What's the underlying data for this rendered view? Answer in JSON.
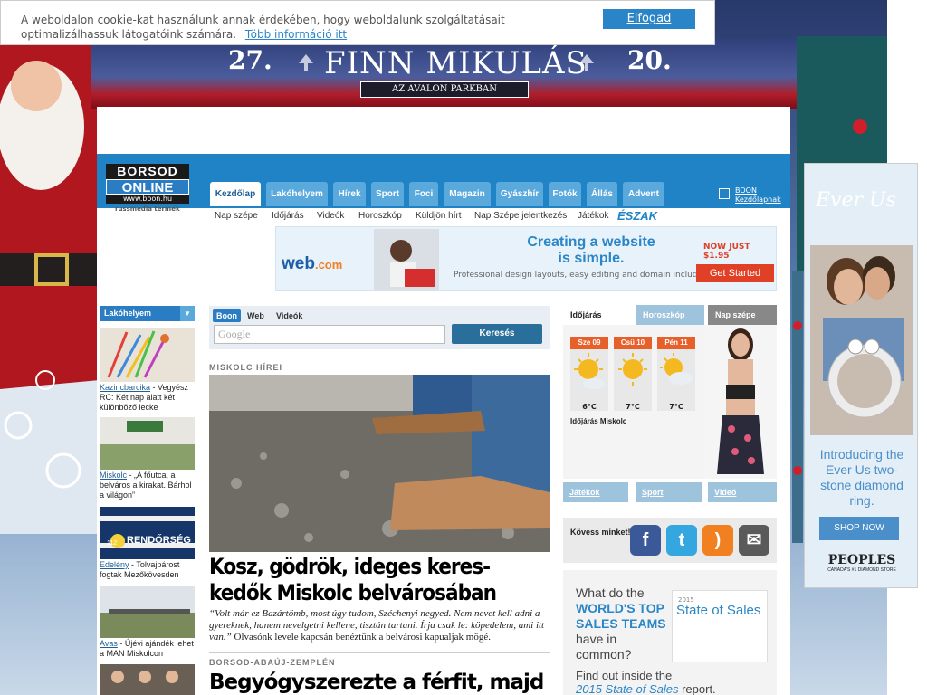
{
  "cookie": {
    "text": "A weboldalon cookie-kat használunk annak érdekében, hogy weboldalunk szolgáltatásait optimalizálhassuk látogatóink számára.",
    "more_link": "Több információ itt",
    "accept_button": "Elfogad"
  },
  "banner": {
    "date_left": "27.",
    "title": "FINN MIKULÁS",
    "date_right": "20.",
    "subtitle": "AZ AVALON PARKBAN"
  },
  "logo": {
    "top": "BORSOD",
    "mid": "ONLINE",
    "url": "www.boon.hu",
    "sub": "russmedia termék"
  },
  "nav": {
    "tabs": [
      "Kezdőlap",
      "Lakóhelyem",
      "Hírek",
      "Sport",
      "Foci",
      "Magazin",
      "Gyászhír",
      "Fotók",
      "Állás",
      "Advent"
    ],
    "active_index": 0,
    "boon_link_line1": "BOON",
    "boon_link_line2": "Kezdőlapnak",
    "subnav": [
      "Nap szépe",
      "Időjárás",
      "Videók",
      "Horoszkóp",
      "Küldjön hírt",
      "Nap Szépe jelentkezés",
      "Játékok"
    ],
    "eszak": "ÉSZAK"
  },
  "webad": {
    "logo": "web",
    "logo_suffix": ".com",
    "headline1": "Creating a website",
    "headline2": "is simple.",
    "small": "Professional design layouts, easy editing and domain included.",
    "price": "NOW JUST $1.95",
    "cta": "Get Started"
  },
  "sidebar": {
    "location_label": "Lakóhelyem",
    "items": [
      {
        "loc": "Kazincbarcika",
        "text": " - Vegyész RC: Két nap alatt két különböző lecke"
      },
      {
        "loc": "Miskolc",
        "text": " - „A főutca, a belváros a kirakat. Bárhol a világon”"
      },
      {
        "loc": "Edelény",
        "text": " - Tolvajpárost fogtak Mezőkövesden"
      },
      {
        "loc": "Avas",
        "text": " - Újévi ajándék lehet a MAN Miskolcon"
      }
    ],
    "rendorseg": "RENDŐRSÉG",
    "phone": "112"
  },
  "search": {
    "tabs": [
      "Boon",
      "Web",
      "Videók"
    ],
    "placeholder": "Google",
    "button": "Keresés"
  },
  "articles": {
    "section1": "MISKOLC HÍREI",
    "headline1": "Kosz, gödrök, ideges keres-kedők Miskolc belvárosában",
    "lead_quote": "“Volt már ez Bazártömb, most úgy tudom, Széchenyi negyed. Nem nevet kell adni a gyereknek, hanem nevelgetni kellene, tisztán tartani. Írja csak le: köpedelem, ami itt van.”",
    "lead_rest": " Olvasónk levele kapcsán benéztünk a belvárosi kapualjak mögé.",
    "section2": "BORSOD-ABAÚJ-ZEMPLÉN",
    "headline2": "Begyógyszerezte a férfit, majd"
  },
  "right": {
    "tabs": [
      "Időjárás",
      "Horoszkóp",
      "Nap szépe"
    ],
    "weather": [
      {
        "day": "Sze 09",
        "temp": "6°C"
      },
      {
        "day": "Csü 10",
        "temp": "7°C"
      },
      {
        "day": "Pén 11",
        "temp": "7°C"
      }
    ],
    "weather_label": "Időjárás Miskolc",
    "buttons": [
      "Játékok",
      "Sport",
      "Videó"
    ],
    "follow": "Kövess minket!",
    "social": [
      "f",
      "t",
      "rss",
      "mail"
    ]
  },
  "sfad": {
    "q1": "What do the",
    "q2": "WORLD'S TOP SALES TEAMS",
    "q3": "have in common?",
    "card_year": "2015",
    "card_title": "State of Sales",
    "find1": "Find out inside the",
    "find2": "2015 State of Sales",
    "find3": " report."
  },
  "adright": {
    "brand": "Ever Us",
    "text": "Introducing the Ever Us two-stone diamond ring.",
    "cta": "SHOP NOW",
    "store": "PEOPLES",
    "store_sub": "CANADA'S #1 DIAMOND STORE"
  },
  "colors": {
    "header_blue": "#1f83c6",
    "tab_blue": "#5aa9dd",
    "accent_orange": "#e85f2a"
  }
}
